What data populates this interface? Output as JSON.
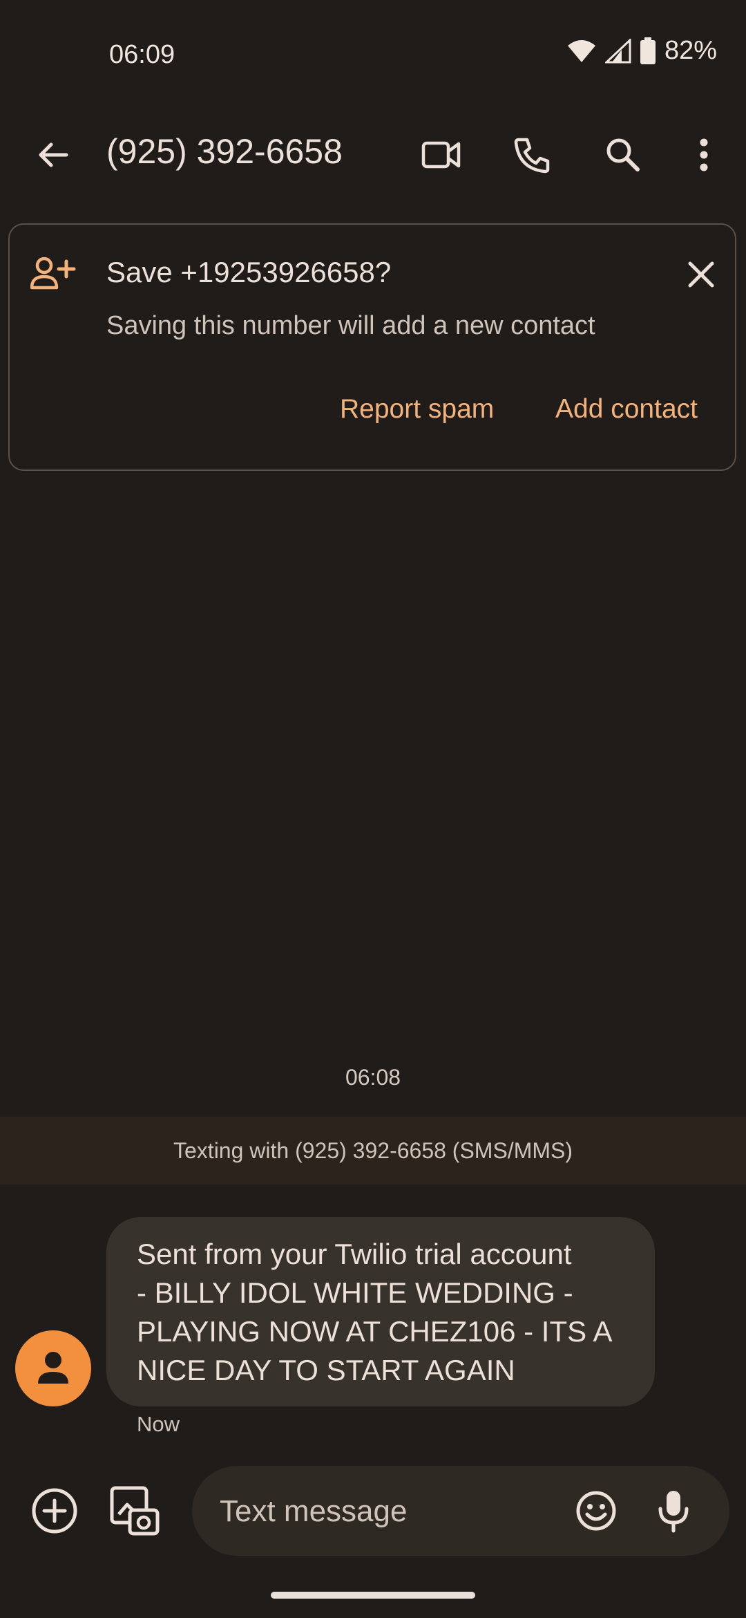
{
  "status_bar": {
    "time": "06:09",
    "battery": "82%"
  },
  "app_bar": {
    "title": "(925) 392-6658",
    "icons": [
      "back-arrow-icon",
      "video-call-icon",
      "phone-icon",
      "search-icon",
      "more-vert-icon"
    ]
  },
  "save_card": {
    "title": "Save +19253926658?",
    "subtitle": "Saving this number will add a new contact",
    "report_spam": "Report spam",
    "add_contact": "Add contact"
  },
  "conversation": {
    "timestamp": "06:08",
    "info": "Texting with (925) 392-6658 (SMS/MMS)",
    "messages": [
      {
        "lines": [
          "Sent from your Twilio trial account",
          "- BILLY IDOL WHITE WEDDING -",
          "PLAYING NOW AT CHEZ106 - ITS A",
          "NICE DAY TO START AGAIN"
        ],
        "time": "Now"
      }
    ]
  },
  "compose": {
    "placeholder": "Text message"
  },
  "colors": {
    "background": "#201c19",
    "accent": "#f3b37a",
    "avatar": "#f3903e",
    "bubble": "#38322d"
  }
}
